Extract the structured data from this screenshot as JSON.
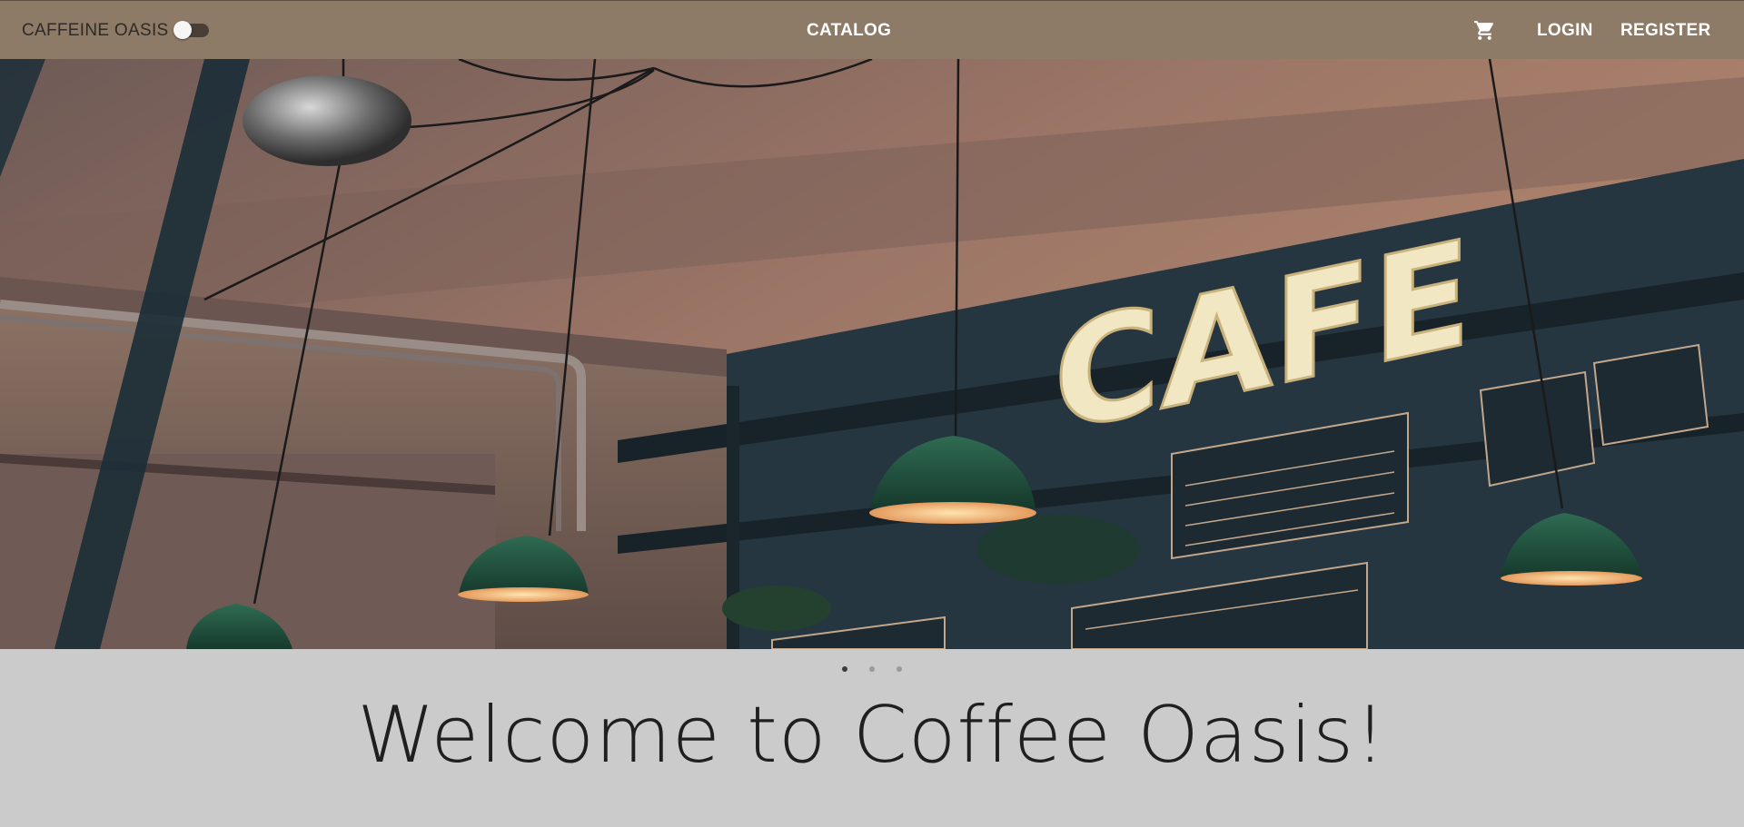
{
  "navbar": {
    "brand": "CAFFEINE OASIS",
    "theme_toggle_on": false,
    "catalog_label": "CATALOG",
    "cart_icon": "shopping-cart-icon",
    "login_label": "LOGIN",
    "register_label": "REGISTER"
  },
  "hero": {
    "image": "cafe-interior-with-pendant-lamps",
    "sign_text": "CAFE",
    "slide_count": 3,
    "active_slide": 1
  },
  "main": {
    "headline": "Welcome to Coffee Oasis!"
  },
  "colors": {
    "navbar": "#8d7a67",
    "page_background": "#cbcbcb",
    "headline": "#1f1f1f"
  }
}
